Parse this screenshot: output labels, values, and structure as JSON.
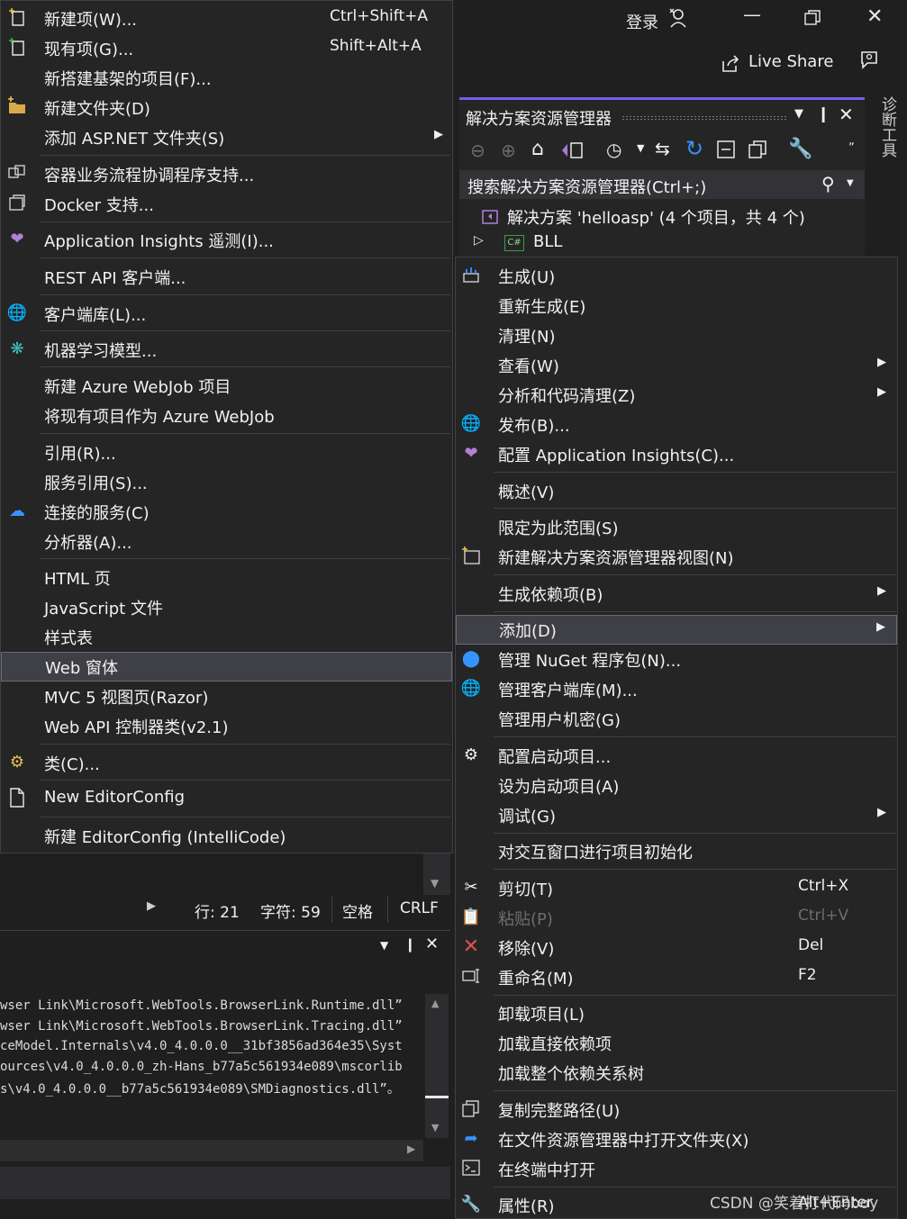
{
  "titlebar": {
    "login": "登录",
    "live_share": "Live Share"
  },
  "solution_explorer": {
    "title": "解决方案资源管理器",
    "search_placeholder": "搜索解决方案资源管理器(Ctrl+;)",
    "solution_item": "解决方案 'helloasp' (4 个项目，共 4 个)",
    "project_item": "BLL"
  },
  "side_tab": {
    "label": "诊断工具"
  },
  "add_menu": {
    "items": [
      {
        "label": "新建项(W)...",
        "shortcut": "Ctrl+Shift+A",
        "icon": "new-item-icon"
      },
      {
        "label": "现有项(G)...",
        "shortcut": "Shift+Alt+A",
        "icon": "existing-item-icon"
      },
      {
        "label": "新搭建基架的项目(F)..."
      },
      {
        "label": "新建文件夹(D)",
        "icon": "new-folder-icon"
      },
      {
        "label": "添加 ASP.NET 文件夹(S)"
      },
      {
        "label": "容器业务流程协调程序支持...",
        "icon": "container-icon"
      },
      {
        "label": "Docker 支持...",
        "icon": "docker-icon"
      },
      {
        "label": "Application Insights 遥测(I)...",
        "icon": "app-insights-icon"
      },
      {
        "label": "REST API 客户端..."
      },
      {
        "label": "客户端库(L)...",
        "icon": "client-library-icon"
      },
      {
        "label": "机器学习模型...",
        "icon": "ml-model-icon"
      },
      {
        "label": "新建 Azure WebJob 项目"
      },
      {
        "label": "将现有项目作为 Azure WebJob"
      },
      {
        "label": "引用(R)..."
      },
      {
        "label": "服务引用(S)..."
      },
      {
        "label": "连接的服务(C)",
        "icon": "connected-service-icon"
      },
      {
        "label": "分析器(A)..."
      },
      {
        "label": "HTML 页"
      },
      {
        "label": "JavaScript 文件"
      },
      {
        "label": "样式表"
      },
      {
        "label": "Web 窗体"
      },
      {
        "label": "MVC 5 视图页(Razor)"
      },
      {
        "label": "Web API 控制器类(v2.1)"
      },
      {
        "label": "类(C)...",
        "icon": "class-icon"
      },
      {
        "label": "New EditorConfig",
        "icon": "file-icon"
      },
      {
        "label": "新建 EditorConfig (IntelliCode)"
      }
    ]
  },
  "context_menu": {
    "items": [
      {
        "label": "生成(U)",
        "icon": "build-icon"
      },
      {
        "label": "重新生成(E)"
      },
      {
        "label": "清理(N)"
      },
      {
        "label": "查看(W)"
      },
      {
        "label": "分析和代码清理(Z)"
      },
      {
        "label": "发布(B)...",
        "icon": "publish-icon"
      },
      {
        "label": "配置 Application Insights(C)...",
        "icon": "app-insights-icon"
      },
      {
        "label": "概述(V)"
      },
      {
        "label": "限定为此范围(S)"
      },
      {
        "label": "新建解决方案资源管理器视图(N)",
        "icon": "new-view-icon"
      },
      {
        "label": "生成依赖项(B)"
      },
      {
        "label": "添加(D)"
      },
      {
        "label": "管理 NuGet 程序包(N)...",
        "icon": "nuget-icon"
      },
      {
        "label": "管理客户端库(M)...",
        "icon": "client-library-icon"
      },
      {
        "label": "管理用户机密(G)"
      },
      {
        "label": "配置启动项目...",
        "icon": "gear-icon"
      },
      {
        "label": "设为启动项目(A)"
      },
      {
        "label": "调试(G)"
      },
      {
        "label": "对交互窗口进行项目初始化"
      },
      {
        "label": "剪切(T)",
        "shortcut": "Ctrl+X",
        "icon": "cut-icon"
      },
      {
        "label": "粘贴(P)",
        "shortcut": "Ctrl+V",
        "icon": "paste-icon"
      },
      {
        "label": "移除(V)",
        "shortcut": "Del",
        "icon": "remove-icon"
      },
      {
        "label": "重命名(M)",
        "shortcut": "F2",
        "icon": "rename-icon"
      },
      {
        "label": "卸载项目(L)"
      },
      {
        "label": "加载直接依赖项"
      },
      {
        "label": "加载整个依赖关系树"
      },
      {
        "label": "复制完整路径(U)",
        "icon": "copy-icon"
      },
      {
        "label": "在文件资源管理器中打开文件夹(X)",
        "icon": "open-folder-icon"
      },
      {
        "label": "在终端中打开",
        "icon": "terminal-icon"
      },
      {
        "label": "属性(R)",
        "shortcut": "Alt+Enter",
        "icon": "wrench-icon"
      }
    ]
  },
  "status": {
    "line": "行: 21",
    "char": "字符: 59",
    "space": "空格",
    "eol": "CRLF"
  },
  "output": {
    "lines": [
      "wser Link\\Microsoft.WebTools.BrowserLink.Runtime.dll”",
      "wser Link\\Microsoft.WebTools.BrowserLink.Tracing.dll”",
      "ceModel.Internals\\v4.0_4.0.0.0__31bf3856ad364e35\\Syst",
      "ources\\v4.0_4.0.0.0_zh-Hans_b77a5c561934e089\\mscorlib",
      "s\\v4.0_4.0.0.0__b77a5c561934e089\\SMDiagnostics.dll”。"
    ]
  },
  "watermark": "CSDN @笑着打代码boy"
}
